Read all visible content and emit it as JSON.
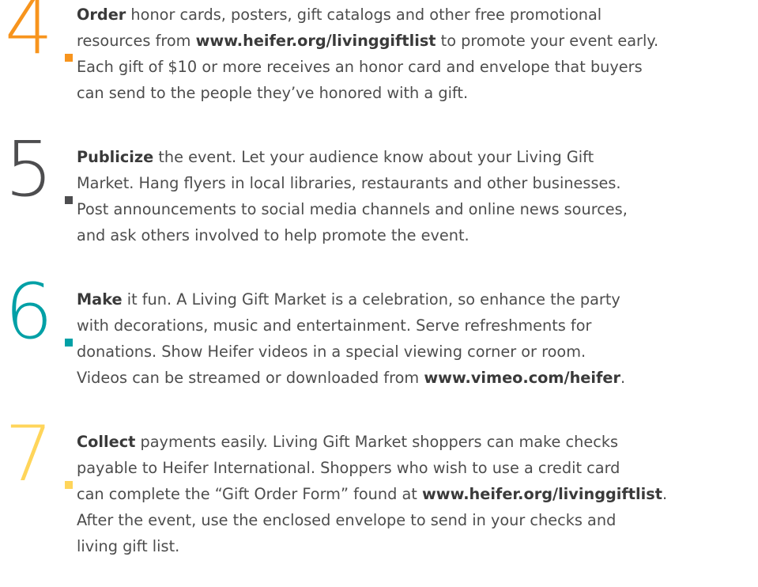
{
  "colors": {
    "step4": "#f7941d",
    "step5": "#4d4d4f",
    "step6": "#00a0a6",
    "step7": "#ffd55a",
    "body_text": "#4d4d4d"
  },
  "steps": [
    {
      "number": "4",
      "lead": "Order",
      "line1_rest": " honor cards, posters, gift catalogs and other free promotional",
      "line2_pre": "resources from ",
      "line2_url": "www.heifer.org/livinggiftlist",
      "line2_post": " to promote your event early.",
      "line3": "Each gift of $10 or more receives an honor card and envelope that buyers",
      "line4": "can send to the people they’ve honored with a gift."
    },
    {
      "number": "5",
      "lead": "Publicize",
      "line1_rest": " the event. Let your audience know about your Living Gift",
      "line2": "Market. Hang flyers in local libraries, restaurants and other businesses.",
      "line3": "Post announcements to social media channels and online news sources,",
      "line4": "and ask others involved to help promote the event."
    },
    {
      "number": "6",
      "lead": "Make",
      "line1_rest": " it fun. A Living Gift Market is a celebration, so enhance the party",
      "line2": "with decorations, music and entertainment. Serve refreshments for",
      "line3": "donations. Show Heifer videos in a special viewing corner or room.",
      "line4_pre": "Videos can be streamed or downloaded from ",
      "line4_url": "www.vimeo.com/heifer",
      "line4_post": "."
    },
    {
      "number": "7",
      "lead": "Collect",
      "line1_rest": " payments easily. Living Gift Market shoppers can make checks",
      "line2": "payable to Heifer International. Shoppers who wish to use a credit card",
      "line3_pre": "can complete the “Gift Order Form” found at ",
      "line3_url": "www.heifer.org/livinggiftlist",
      "line3_post": ".",
      "line4": "After the event, use the enclosed envelope to send in your checks and",
      "line5": "living gift list."
    }
  ]
}
